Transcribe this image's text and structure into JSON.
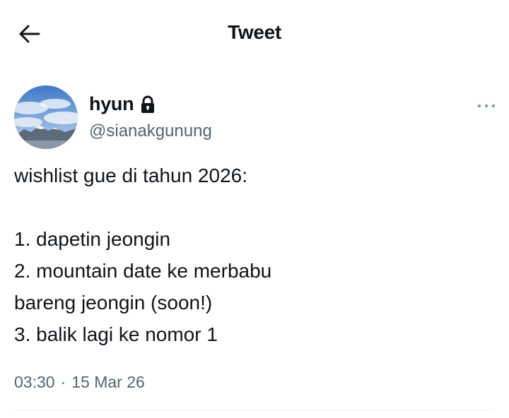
{
  "header": {
    "title": "Tweet",
    "back_icon": "arrow-left-icon"
  },
  "tweet": {
    "author": {
      "display_name": "hyun",
      "handle": "@sianakgunung",
      "protected_icon": "lock-icon",
      "avatar": "mountain-sky-avatar"
    },
    "more_icon": "more-horizontal-icon",
    "text_lines": [
      "wishlist gue di tahun 2026:",
      "",
      "1. dapetin jeongin",
      "2. mountain date ke merbabu",
      "bareng jeongin (soon!)",
      "3. balik lagi ke nomor 1"
    ],
    "time": "03:30",
    "separator": "·",
    "date": "15 Mar 26"
  },
  "colors": {
    "text_primary": "#0f1419",
    "text_secondary": "#536471",
    "divider": "#eff3f4"
  }
}
